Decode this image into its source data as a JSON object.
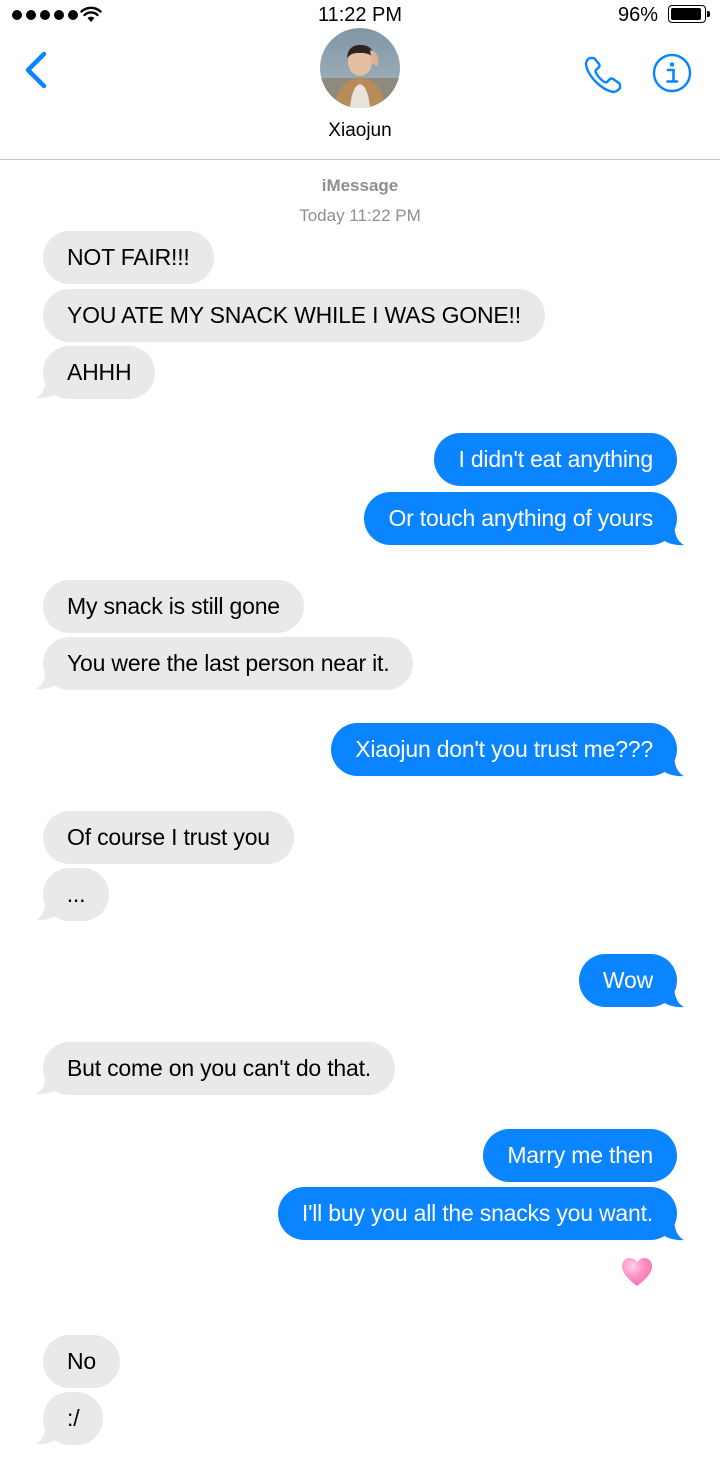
{
  "status_bar": {
    "time": "11:22 PM",
    "battery_percent": "96%",
    "battery_level": 0.96
  },
  "header": {
    "contact_name": "Xiaojun"
  },
  "thread": {
    "service": "iMessage",
    "timestamp": "Today 11:22 PM"
  },
  "messages": [
    {
      "from": "them",
      "text": "NOT FAIR!!!"
    },
    {
      "from": "them",
      "text": "YOU ATE MY SNACK WHILE I WAS GONE!!"
    },
    {
      "from": "them",
      "text": "AHHH"
    },
    {
      "from": "me",
      "text": "I didn't eat anything"
    },
    {
      "from": "me",
      "text": "Or touch anything of yours"
    },
    {
      "from": "them",
      "text": "My snack is still gone"
    },
    {
      "from": "them",
      "text": "You were the last person near it."
    },
    {
      "from": "me",
      "text": "Xiaojun don't you trust me???"
    },
    {
      "from": "them",
      "text": "Of course I trust you"
    },
    {
      "from": "them",
      "text": "..."
    },
    {
      "from": "me",
      "text": "Wow"
    },
    {
      "from": "them",
      "text": "But come on you can't do that."
    },
    {
      "from": "me",
      "text": "Marry me then"
    },
    {
      "from": "me",
      "text": "I'll buy you all the snacks you want."
    },
    {
      "from": "them",
      "text": "No"
    },
    {
      "from": "them",
      "text": ":/"
    }
  ],
  "reaction": {
    "icon": "pink-heart-emoji"
  },
  "colors": {
    "accent": "#0b84ff",
    "incoming_bubble": "#e9e9eb",
    "meta_text": "#8e8e93"
  }
}
